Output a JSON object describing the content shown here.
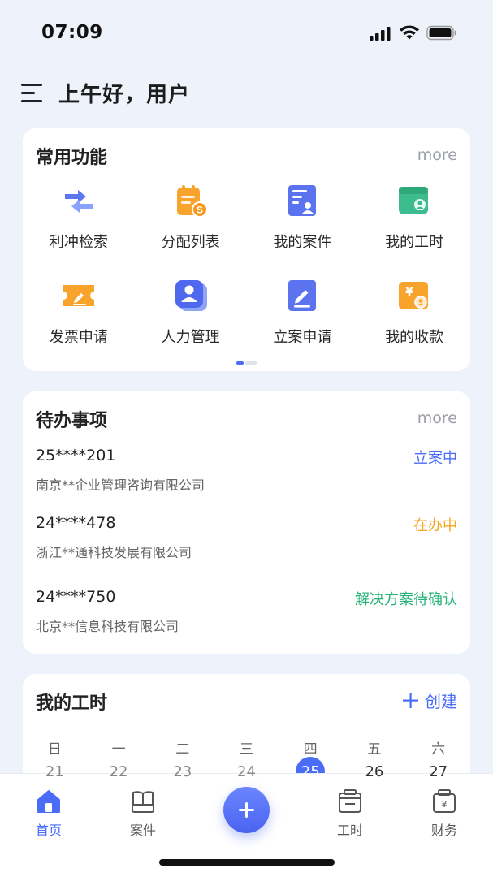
{
  "status_bar": {
    "time": "07:09",
    "icons": [
      "signal-icon",
      "wifi-icon",
      "battery-icon"
    ]
  },
  "header": {
    "greeting": "上午好，用户",
    "icon": "menu-icon"
  },
  "functions": {
    "title": "常用功能",
    "more": "more",
    "items": [
      {
        "label": "利冲检索",
        "icon": "swap-arrows-icon"
      },
      {
        "label": "分配列表",
        "icon": "clipboard-coin-icon"
      },
      {
        "label": "我的案件",
        "icon": "case-document-icon"
      },
      {
        "label": "我的工时",
        "icon": "calendar-user-icon"
      },
      {
        "label": "发票申请",
        "icon": "invoice-ticket-icon"
      },
      {
        "label": "人力管理",
        "icon": "person-card-icon"
      },
      {
        "label": "立案申请",
        "icon": "edit-document-icon"
      },
      {
        "label": "我的收款",
        "icon": "yuan-receipt-icon"
      }
    ],
    "page_indicator": {
      "current": 1,
      "total": 2
    }
  },
  "todos": {
    "title": "待办事项",
    "more": "more",
    "items": [
      {
        "number": "25****201",
        "company": "南京**企业管理咨询有限公司",
        "status": "立案中",
        "status_color": "#4a6cf7"
      },
      {
        "number": "24****478",
        "company": "浙江**通科技发展有限公司",
        "status": "在办中",
        "status_color": "#f5a623"
      },
      {
        "number": "24****750",
        "company": "北京**信息科技有限公司",
        "status": "解决方案待确认",
        "status_color": "#27b27a"
      }
    ]
  },
  "hours": {
    "title": "我的工时",
    "create_label": "创建",
    "weekdays": [
      "日",
      "一",
      "二",
      "三",
      "四",
      "五",
      "六"
    ],
    "dates": [
      "21",
      "22",
      "23",
      "24",
      "25",
      "26",
      "27"
    ],
    "selected_date": "25"
  },
  "tab_bar": {
    "tabs": [
      {
        "label": "首页",
        "icon": "home-icon",
        "active": true
      },
      {
        "label": "案件",
        "icon": "book-icon",
        "active": false
      },
      {
        "label": "工时",
        "icon": "timesheet-icon",
        "active": false
      },
      {
        "label": "财务",
        "icon": "finance-icon",
        "active": false
      }
    ],
    "center_button_icon": "plus-icon"
  },
  "colors": {
    "accent": "#4a6cf7",
    "background": "#eef2fb",
    "orange": "#f5a623",
    "green": "#27b27a"
  }
}
